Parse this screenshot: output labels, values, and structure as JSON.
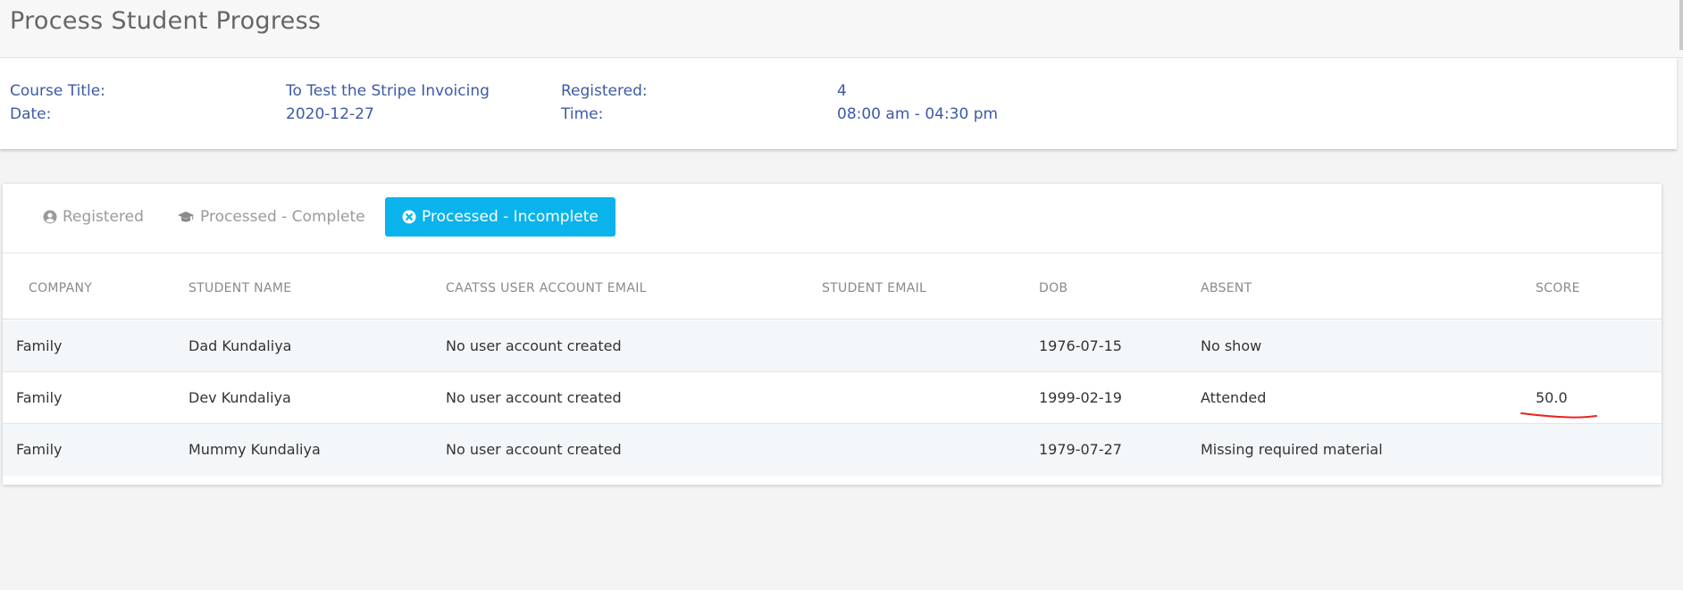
{
  "header": {
    "title": "Process Student Progress"
  },
  "info": {
    "course_title_label": "Course Title:",
    "course_title_value": "To Test the Stripe Invoicing",
    "date_label": "Date:",
    "date_value": "2020-12-27",
    "registered_label": "Registered:",
    "registered_value": "4",
    "time_label": "Time:",
    "time_value": "08:00 am - 04:30 pm"
  },
  "tabs": [
    {
      "label": "Registered",
      "icon": "user-circle-icon"
    },
    {
      "label": "Processed - Complete",
      "icon": "graduation-cap-icon"
    },
    {
      "label": "Processed - Incomplete",
      "icon": "times-circle-icon",
      "active": true
    }
  ],
  "table": {
    "columns": [
      "COMPANY",
      "STUDENT NAME",
      "CAATSS USER ACCOUNT EMAIL",
      "STUDENT EMAIL",
      "DOB",
      "ABSENT",
      "SCORE"
    ],
    "rows": [
      {
        "company": "Family",
        "student_name": "Dad Kundaliya",
        "caatss_email": "No user account created",
        "student_email": "",
        "dob": "1976-07-15",
        "absent": "No show",
        "score": ""
      },
      {
        "company": "Family",
        "student_name": "Dev Kundaliya",
        "caatss_email": "No user account created",
        "student_email": "",
        "dob": "1999-02-19",
        "absent": "Attended",
        "score": "50.0"
      },
      {
        "company": "Family",
        "student_name": "Mummy Kundaliya",
        "caatss_email": "No user account created",
        "student_email": "",
        "dob": "1979-07-27",
        "absent": "Missing required material",
        "score": ""
      }
    ]
  },
  "colors": {
    "accent": "#0ab3ec",
    "info_text": "#3d5aa8",
    "annotation_red": "#e8231f"
  }
}
